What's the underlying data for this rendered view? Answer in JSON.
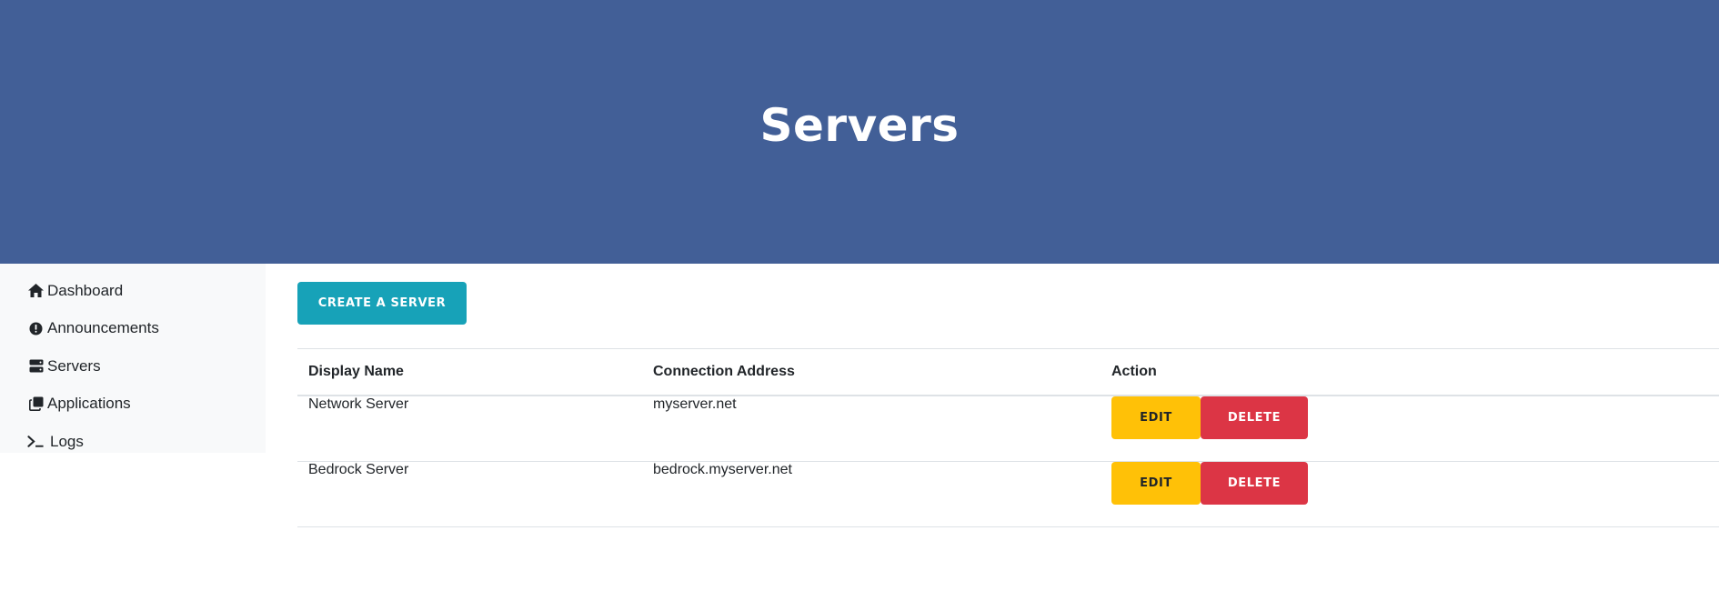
{
  "page": {
    "title": "Servers"
  },
  "colors": {
    "hero_bg": "#425f97",
    "sidebar_bg": "#f8f9fa",
    "create_button": "#17a2b8",
    "edit_button": "#ffc107",
    "delete_button": "#dc3545"
  },
  "sidebar": {
    "items": [
      {
        "label": "Dashboard",
        "icon": "home-icon"
      },
      {
        "label": "Announcements",
        "icon": "exclamation-circle-icon"
      },
      {
        "label": "Servers",
        "icon": "server-icon"
      },
      {
        "label": "Applications",
        "icon": "copy-icon"
      },
      {
        "label": "Logs",
        "icon": "terminal-icon"
      }
    ]
  },
  "main": {
    "create_button_label": "CREATE A SERVER",
    "table": {
      "headers": [
        "Display Name",
        "Connection Address",
        "Action"
      ],
      "rows": [
        {
          "name": "Network Server",
          "address": "myserver.net"
        },
        {
          "name": "Bedrock Server",
          "address": "bedrock.myserver.net"
        }
      ],
      "edit_label": "EDIT",
      "delete_label": "DELETE"
    }
  }
}
